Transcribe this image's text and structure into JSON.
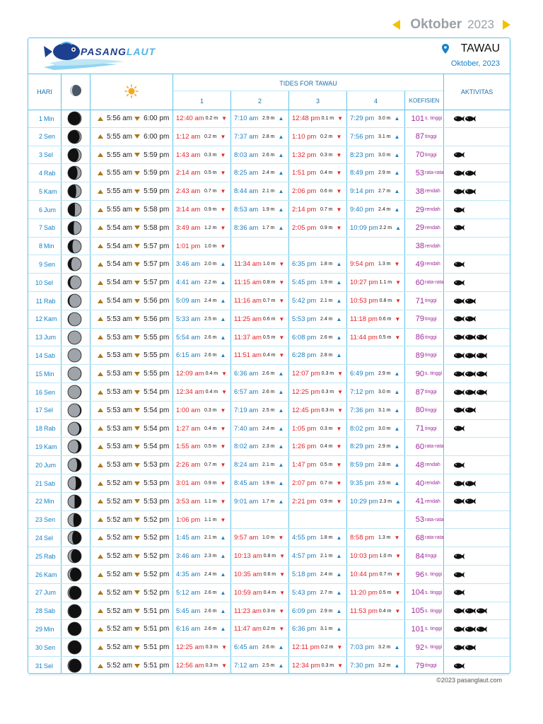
{
  "nav": {
    "month": "Oktober",
    "year": "2023"
  },
  "brand": {
    "part1": "PASANG",
    "part2": "LAUT"
  },
  "location": {
    "name": "TAWAU",
    "date": "Oktober, 2023"
  },
  "table_headers": {
    "hari": "HARI",
    "tides_title": "TIDES FOR TAWAU",
    "tide_cols": [
      "1",
      "2",
      "3",
      "4"
    ],
    "koefisien": "KOEFISIEN",
    "aktivitas": "AKTIVITAS"
  },
  "rows": [
    {
      "d": "1",
      "day": "Min",
      "rise": "5:56 am",
      "set": "6:00 pm",
      "moon": 0.97,
      "t": [
        [
          "12:40 am",
          "0.2 m",
          "L"
        ],
        [
          "7:10 am",
          "2.9 m",
          "H"
        ],
        [
          "12:48 pm",
          "0.1 m",
          "L"
        ],
        [
          "7:29 pm",
          "3.0 m",
          "H"
        ]
      ],
      "k": "101",
      "kl": "s. tinggi",
      "f": 2
    },
    {
      "d": "2",
      "day": "Sen",
      "rise": "5:55 am",
      "set": "6:00 pm",
      "moon": 0.9,
      "t": [
        [
          "1:12 am",
          "0.2 m",
          "L"
        ],
        [
          "7:37 am",
          "2.8 m",
          "H"
        ],
        [
          "1:10 pm",
          "0.2 m",
          "L"
        ],
        [
          "7:56 pm",
          "3.1 m",
          "H"
        ]
      ],
      "k": "87",
      "kl": "tinggi",
      "f": 0
    },
    {
      "d": "3",
      "day": "Sel",
      "rise": "5:55 am",
      "set": "5:59 pm",
      "moon": 0.82,
      "t": [
        [
          "1:43 am",
          "0.3 m",
          "L"
        ],
        [
          "8:03 am",
          "2.6 m",
          "H"
        ],
        [
          "1:32 pm",
          "0.3 m",
          "L"
        ],
        [
          "8:23 pm",
          "3.0 m",
          "H"
        ]
      ],
      "k": "70",
      "kl": "tinggi",
      "f": 1
    },
    {
      "d": "4",
      "day": "Rab",
      "rise": "5:55 am",
      "set": "5:59 pm",
      "moon": 0.73,
      "t": [
        [
          "2:14 am",
          "0.5 m",
          "L"
        ],
        [
          "8:25 am",
          "2.4 m",
          "H"
        ],
        [
          "1:51 pm",
          "0.4 m",
          "L"
        ],
        [
          "8:49 pm",
          "2.9 m",
          "H"
        ]
      ],
      "k": "53",
      "kl": "rata-rata",
      "f": 2
    },
    {
      "d": "5",
      "day": "Kam",
      "rise": "5:55 am",
      "set": "5:59 pm",
      "moon": 0.63,
      "t": [
        [
          "2:43 am",
          "0.7 m",
          "L"
        ],
        [
          "8:44 am",
          "2.1 m",
          "H"
        ],
        [
          "2:06 pm",
          "0.6 m",
          "L"
        ],
        [
          "9:14 pm",
          "2.7 m",
          "H"
        ]
      ],
      "k": "38",
      "kl": "rendah",
      "f": 2
    },
    {
      "d": "6",
      "day": "Jum",
      "rise": "5:55 am",
      "set": "5:58 pm",
      "moon": 0.53,
      "t": [
        [
          "3:14 am",
          "0.9 m",
          "L"
        ],
        [
          "8:53 am",
          "1.9 m",
          "H"
        ],
        [
          "2:14 pm",
          "0.7 m",
          "L"
        ],
        [
          "9:40 pm",
          "2.4 m",
          "H"
        ]
      ],
      "k": "29",
      "kl": "rendah",
      "f": 1
    },
    {
      "d": "7",
      "day": "Sab",
      "rise": "5:54 am",
      "set": "5:58 pm",
      "moon": 0.43,
      "t": [
        [
          "3:49 am",
          "1.2 m",
          "L"
        ],
        [
          "8:36 am",
          "1.7 m",
          "H"
        ],
        [
          "2:05 pm",
          "0.9 m",
          "L"
        ],
        [
          "10:09 pm",
          "2.2 m",
          "H"
        ]
      ],
      "k": "29",
      "kl": "rendah",
      "f": 1
    },
    {
      "d": "8",
      "day": "Min",
      "rise": "5:54 am",
      "set": "5:57 pm",
      "moon": 0.33,
      "t": [
        [
          "1:01 pm",
          "1.0 m",
          "L"
        ],
        null,
        null,
        null
      ],
      "k": "38",
      "kl": "rendah",
      "f": 0
    },
    {
      "d": "9",
      "day": "Sen",
      "rise": "5:54 am",
      "set": "5:57 pm",
      "moon": 0.24,
      "t": [
        [
          "3:46 am",
          "2.0 m",
          "H"
        ],
        [
          "11:34 am",
          "1.0 m",
          "L"
        ],
        [
          "6:35 pm",
          "1.8 m",
          "H"
        ],
        [
          "9:54 pm",
          "1.3 m",
          "L"
        ]
      ],
      "k": "49",
      "kl": "rendah",
      "f": 1
    },
    {
      "d": "10",
      "day": "Sel",
      "rise": "5:54 am",
      "set": "5:57 pm",
      "moon": 0.16,
      "t": [
        [
          "4:41 am",
          "2.2 m",
          "H"
        ],
        [
          "11:15 am",
          "0.8 m",
          "L"
        ],
        [
          "5:45 pm",
          "1.9 m",
          "H"
        ],
        [
          "10:27 pm",
          "1.1 m",
          "L"
        ]
      ],
      "k": "60",
      "kl": "rata-rata",
      "f": 1
    },
    {
      "d": "11",
      "day": "Rab",
      "rise": "5:54 am",
      "set": "5:56 pm",
      "moon": 0.09,
      "t": [
        [
          "5:09 am",
          "2.4 m",
          "H"
        ],
        [
          "11:16 am",
          "0.7 m",
          "L"
        ],
        [
          "5:42 pm",
          "2.1 m",
          "H"
        ],
        [
          "10:53 pm",
          "0.8 m",
          "L"
        ]
      ],
      "k": "71",
      "kl": "tinggi",
      "f": 2
    },
    {
      "d": "12",
      "day": "Kam",
      "rise": "5:53 am",
      "set": "5:56 pm",
      "moon": 0.04,
      "t": [
        [
          "5:33 am",
          "2.5 m",
          "H"
        ],
        [
          "11:25 am",
          "0.6 m",
          "L"
        ],
        [
          "5:53 pm",
          "2.4 m",
          "H"
        ],
        [
          "11:18 pm",
          "0.6 m",
          "L"
        ]
      ],
      "k": "79",
      "kl": "tinggi",
      "f": 2
    },
    {
      "d": "13",
      "day": "Jum",
      "rise": "5:53 am",
      "set": "5:55 pm",
      "moon": 0.01,
      "t": [
        [
          "5:54 am",
          "2.6 m",
          "H"
        ],
        [
          "11:37 am",
          "0.5 m",
          "L"
        ],
        [
          "6:08 pm",
          "2.6 m",
          "H"
        ],
        [
          "11:44 pm",
          "0.5 m",
          "L"
        ]
      ],
      "k": "86",
      "kl": "tinggi",
      "f": 3
    },
    {
      "d": "14",
      "day": "Sab",
      "rise": "5:53 am",
      "set": "5:55 pm",
      "moon": 0.0,
      "t": [
        [
          "6:15 am",
          "2.6 m",
          "H"
        ],
        [
          "11:51 am",
          "0.4 m",
          "L"
        ],
        [
          "6:28 pm",
          "2.8 m",
          "H"
        ],
        null
      ],
      "k": "89",
      "kl": "tinggi",
      "f": 3
    },
    {
      "d": "15",
      "day": "Min",
      "rise": "5:53 am",
      "set": "5:55 pm",
      "moon": 0.01,
      "t": [
        [
          "12:09 am",
          "0.4 m",
          "L"
        ],
        [
          "6:36 am",
          "2.6 m",
          "H"
        ],
        [
          "12:07 pm",
          "0.3 m",
          "L"
        ],
        [
          "6:49 pm",
          "2.9 m",
          "H"
        ]
      ],
      "k": "90",
      "kl": "s. tinggi",
      "f": 3
    },
    {
      "d": "16",
      "day": "Sen",
      "rise": "5:53 am",
      "set": "5:54 pm",
      "moon": 0.03,
      "t": [
        [
          "12:34 am",
          "0.4 m",
          "L"
        ],
        [
          "6:57 am",
          "2.6 m",
          "H"
        ],
        [
          "12:25 pm",
          "0.3 m",
          "L"
        ],
        [
          "7:12 pm",
          "3.0 m",
          "H"
        ]
      ],
      "k": "87",
      "kl": "tinggi",
      "f": 3
    },
    {
      "d": "17",
      "day": "Sel",
      "rise": "5:53 am",
      "set": "5:54 pm",
      "moon": 0.07,
      "t": [
        [
          "1:00 am",
          "0.3 m",
          "L"
        ],
        [
          "7:19 am",
          "2.5 m",
          "H"
        ],
        [
          "12:45 pm",
          "0.3 m",
          "L"
        ],
        [
          "7:36 pm",
          "3.1 m",
          "H"
        ]
      ],
      "k": "80",
      "kl": "tinggi",
      "f": 2
    },
    {
      "d": "18",
      "day": "Rab",
      "rise": "5:53 am",
      "set": "5:54 pm",
      "moon": 0.13,
      "t": [
        [
          "1:27 am",
          "0.4 m",
          "L"
        ],
        [
          "7:40 am",
          "2.4 m",
          "H"
        ],
        [
          "1:05 pm",
          "0.3 m",
          "L"
        ],
        [
          "8:02 pm",
          "3.0 m",
          "H"
        ]
      ],
      "k": "71",
      "kl": "tinggi",
      "f": 1
    },
    {
      "d": "19",
      "day": "Kam",
      "rise": "5:53 am",
      "set": "5:54 pm",
      "moon": 0.21,
      "t": [
        [
          "1:55 am",
          "0.5 m",
          "L"
        ],
        [
          "8:02 am",
          "2.3 m",
          "H"
        ],
        [
          "1:26 pm",
          "0.4 m",
          "L"
        ],
        [
          "8:29 pm",
          "2.9 m",
          "H"
        ]
      ],
      "k": "60",
      "kl": "rata-rata",
      "f": 0
    },
    {
      "d": "20",
      "day": "Jum",
      "rise": "5:53 am",
      "set": "5:53 pm",
      "moon": 0.3,
      "t": [
        [
          "2:26 am",
          "0.7 m",
          "L"
        ],
        [
          "8:24 am",
          "2.1 m",
          "H"
        ],
        [
          "1:47 pm",
          "0.5 m",
          "L"
        ],
        [
          "8:59 pm",
          "2.8 m",
          "H"
        ]
      ],
      "k": "48",
      "kl": "rendah",
      "f": 1
    },
    {
      "d": "21",
      "day": "Sab",
      "rise": "5:52 am",
      "set": "5:53 pm",
      "moon": 0.4,
      "t": [
        [
          "3:01 am",
          "0.9 m",
          "L"
        ],
        [
          "8:45 am",
          "1.9 m",
          "H"
        ],
        [
          "2:07 pm",
          "0.7 m",
          "L"
        ],
        [
          "9:35 pm",
          "2.5 m",
          "H"
        ]
      ],
      "k": "40",
      "kl": "rendah",
      "f": 2
    },
    {
      "d": "22",
      "day": "Min",
      "rise": "5:52 am",
      "set": "5:53 pm",
      "moon": 0.5,
      "t": [
        [
          "3:53 am",
          "1.1 m",
          "L"
        ],
        [
          "9:01 am",
          "1.7 m",
          "H"
        ],
        [
          "2:21 pm",
          "0.9 m",
          "L"
        ],
        [
          "10:29 pm",
          "2.3 m",
          "H"
        ]
      ],
      "k": "41",
      "kl": "rendah",
      "f": 2
    },
    {
      "d": "23",
      "day": "Sen",
      "rise": "5:52 am",
      "set": "5:52 pm",
      "moon": 0.6,
      "t": [
        [
          "1:06 pm",
          "1.1 m",
          "L"
        ],
        null,
        null,
        null
      ],
      "k": "53",
      "kl": "rata-rata",
      "f": 0
    },
    {
      "d": "24",
      "day": "Sel",
      "rise": "5:52 am",
      "set": "5:52 pm",
      "moon": 0.69,
      "t": [
        [
          "1:45 am",
          "2.1 m",
          "H"
        ],
        [
          "9:57 am",
          "1.0 m",
          "L"
        ],
        [
          "4:55 pm",
          "1.8 m",
          "H"
        ],
        [
          "8:58 pm",
          "1.3 m",
          "L"
        ]
      ],
      "k": "68",
      "kl": "rata-rata",
      "f": 0
    },
    {
      "d": "25",
      "day": "Rab",
      "rise": "5:52 am",
      "set": "5:52 pm",
      "moon": 0.78,
      "t": [
        [
          "3:46 am",
          "2.3 m",
          "H"
        ],
        [
          "10:13 am",
          "0.8 m",
          "L"
        ],
        [
          "4:57 pm",
          "2.1 m",
          "H"
        ],
        [
          "10:03 pm",
          "1.0 m",
          "L"
        ]
      ],
      "k": "84",
      "kl": "tinggi",
      "f": 1
    },
    {
      "d": "26",
      "day": "Kam",
      "rise": "5:52 am",
      "set": "5:52 pm",
      "moon": 0.86,
      "t": [
        [
          "4:35 am",
          "2.4 m",
          "H"
        ],
        [
          "10:35 am",
          "0.6 m",
          "L"
        ],
        [
          "5:18 pm",
          "2.4 m",
          "H"
        ],
        [
          "10:44 pm",
          "0.7 m",
          "L"
        ]
      ],
      "k": "96",
      "kl": "s. tinggi",
      "f": 1
    },
    {
      "d": "27",
      "day": "Jum",
      "rise": "5:52 am",
      "set": "5:52 pm",
      "moon": 0.93,
      "t": [
        [
          "5:12 am",
          "2.6 m",
          "H"
        ],
        [
          "10:59 am",
          "0.4 m",
          "L"
        ],
        [
          "5:43 pm",
          "2.7 m",
          "H"
        ],
        [
          "11:20 pm",
          "0.5 m",
          "L"
        ]
      ],
      "k": "104",
      "kl": "s. tinggi",
      "f": 1
    },
    {
      "d": "28",
      "day": "Sab",
      "rise": "5:52 am",
      "set": "5:51 pm",
      "moon": 0.98,
      "t": [
        [
          "5:45 am",
          "2.6 m",
          "H"
        ],
        [
          "11:23 am",
          "0.3 m",
          "L"
        ],
        [
          "6:09 pm",
          "2.9 m",
          "H"
        ],
        [
          "11:53 pm",
          "0.4 m",
          "L"
        ]
      ],
      "k": "105",
      "kl": "s. tinggi",
      "f": 3
    },
    {
      "d": "29",
      "day": "Min",
      "rise": "5:52 am",
      "set": "5:51 pm",
      "moon": 1.0,
      "t": [
        [
          "6:16 am",
          "2.6 m",
          "H"
        ],
        [
          "11:47 am",
          "0.2 m",
          "L"
        ],
        [
          "6:36 pm",
          "3.1 m",
          "H"
        ],
        null
      ],
      "k": "101",
      "kl": "s. tinggi",
      "f": 3
    },
    {
      "d": "30",
      "day": "Sen",
      "rise": "5:52 am",
      "set": "5:51 pm",
      "moon": 0.99,
      "t": [
        [
          "12:25 am",
          "0.3 m",
          "L"
        ],
        [
          "6:45 am",
          "2.6 m",
          "H"
        ],
        [
          "12:11 pm",
          "0.2 m",
          "L"
        ],
        [
          "7:03 pm",
          "3.2 m",
          "H"
        ]
      ],
      "k": "92",
      "kl": "s. tinggi",
      "f": 2
    },
    {
      "d": "31",
      "day": "Sel",
      "rise": "5:52 am",
      "set": "5:51 pm",
      "moon": 0.96,
      "t": [
        [
          "12:56 am",
          "0.3 m",
          "L"
        ],
        [
          "7:12 am",
          "2.5 m",
          "H"
        ],
        [
          "12:34 pm",
          "0.3 m",
          "L"
        ],
        [
          "7:30 pm",
          "3.2 m",
          "H"
        ]
      ],
      "k": "79",
      "kl": "tinggi",
      "f": 1
    }
  ],
  "footer": {
    "text": "©2023  pasanglaut.com"
  },
  "colors": {
    "accent": "#5fc3e8",
    "low_tide": "#e0242c",
    "high_tide": "#1e7fc0",
    "coef": "#9b2a9b",
    "nav_arrow": "#f2c200"
  },
  "icons": {
    "moon_header": "moon-icon",
    "sun_header": "sun-icon",
    "sunrise": "triangle-up-icon",
    "sunset": "triangle-down-icon",
    "activity": "fish-icon",
    "location": "map-pin-icon"
  }
}
